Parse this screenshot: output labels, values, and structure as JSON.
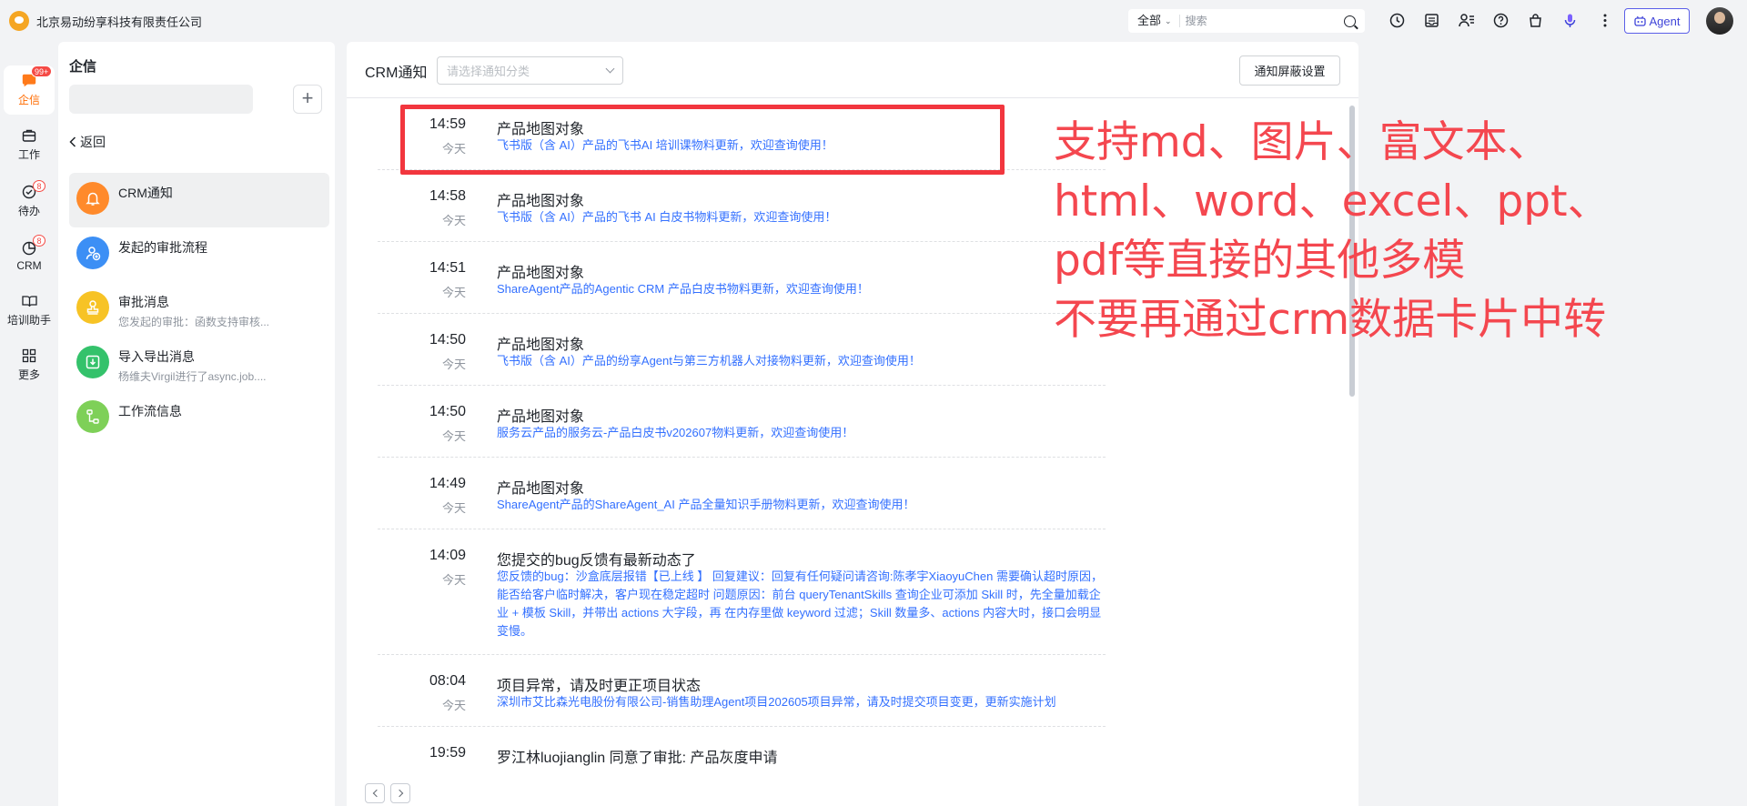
{
  "app": {
    "company": "北京易动纷享科技有限责任公司"
  },
  "search": {
    "scope": "全部",
    "placeholder": "搜索"
  },
  "topbar": {
    "agent_label": "Agent"
  },
  "rail": {
    "items": [
      {
        "label": "企信",
        "badge": "99+"
      },
      {
        "label": "工作"
      },
      {
        "label": "待办",
        "badge": "8"
      },
      {
        "label": "CRM",
        "badge": "8"
      },
      {
        "label": "培训助手"
      },
      {
        "label": "更多"
      }
    ]
  },
  "sidebar": {
    "title": "企信",
    "back_label": "返回",
    "items": [
      {
        "name": "CRM通知",
        "sub": "",
        "color": "#ff8a2b",
        "icon": "bell-icon"
      },
      {
        "name": "发起的审批流程",
        "sub": "",
        "color": "#3c8ff5",
        "icon": "user-approve-icon"
      },
      {
        "name": "审批消息",
        "sub": "您发起的审批：函数支持审核...",
        "color": "#f7c325",
        "icon": "stamp-icon"
      },
      {
        "name": "导入导出消息",
        "sub": "杨维夫Virgil进行了async.job....",
        "color": "#34c26b",
        "icon": "download-icon"
      },
      {
        "name": "工作流信息",
        "sub": "",
        "color": "#7ed058",
        "icon": "workflow-icon"
      }
    ]
  },
  "main": {
    "title": "CRM通知",
    "category_placeholder": "请选择通知分类",
    "mask_button": "通知屏蔽设置",
    "messages": [
      {
        "time": "14:59",
        "day": "今天",
        "title": "产品地图对象",
        "body": "飞书版（含 AI）产品的飞书AI 培训课物料更新，欢迎查询使用！"
      },
      {
        "time": "14:58",
        "day": "今天",
        "title": "产品地图对象",
        "body": "飞书版（含 AI）产品的飞书 AI 白皮书物料更新，欢迎查询使用！"
      },
      {
        "time": "14:51",
        "day": "今天",
        "title": "产品地图对象",
        "body": "ShareAgent产品的Agentic CRM 产品白皮书物料更新，欢迎查询使用！"
      },
      {
        "time": "14:50",
        "day": "今天",
        "title": "产品地图对象",
        "body": "飞书版（含 AI）产品的纷享Agent与第三方机器人对接物料更新，欢迎查询使用！"
      },
      {
        "time": "14:50",
        "day": "今天",
        "title": "产品地图对象",
        "body": "服务云产品的服务云-产品白皮书v202607物料更新，欢迎查询使用！"
      },
      {
        "time": "14:49",
        "day": "今天",
        "title": "产品地图对象",
        "body": "ShareAgent产品的ShareAgent_AI 产品全量知识手册物料更新，欢迎查询使用！"
      },
      {
        "time": "14:09",
        "day": "今天",
        "title": "您提交的bug反馈有最新动态了",
        "body": "您反馈的bug：沙盒底层报错【已上线 】 回复建议：回复有任何疑问请咨询:陈孝宇XiaoyuChen 需要确认超时原因，能否给客户临时解决，客户现在稳定超时 问题原因：前台 queryTenantSkills 查询企业可添加 Skill 时，先全量加载企业 + 模板 Skill，并带出 actions 大字段，再 在内存里做 keyword 过滤；Skill 数量多、actions 内容大时，接口会明显变慢。"
      },
      {
        "time": "08:04",
        "day": "今天",
        "title": "项目异常，请及时更正项目状态",
        "body": "深圳市艾比森光电股份有限公司-销售助理Agent项目202605项目异常，请及时提交项目变更，更新实施计划"
      },
      {
        "time": "19:59",
        "day": "",
        "title": "罗江林luojianglin 同意了审批: 产品灰度申请",
        "body": ""
      }
    ]
  },
  "annotation": {
    "line1": "支持md、图片、富文本、",
    "line2": "html、word、excel、ppt、",
    "line3": "pdf等直接的其他多模",
    "line4": "不要再通过crm数据卡片中转",
    "color": "#f4474f"
  }
}
